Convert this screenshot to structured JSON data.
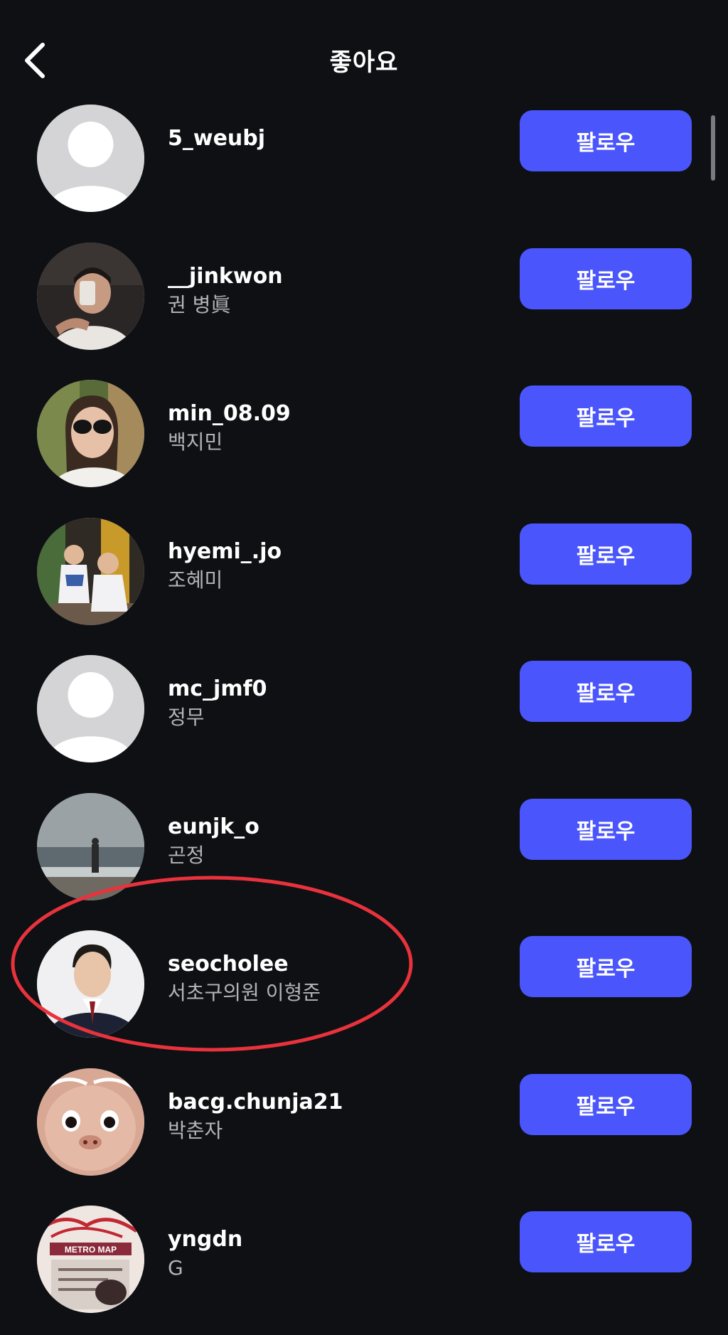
{
  "header": {
    "title": "좋아요",
    "back_icon": "chevron-left-icon"
  },
  "theme": {
    "background": "#0f1014",
    "button_color": "#4a56fb",
    "highlight_color": "#e8323c"
  },
  "users": [
    {
      "username": "5_weubj",
      "full_name": "",
      "button_label": "팔로우",
      "avatar": "default-avatar"
    },
    {
      "username": "__jinkwon",
      "full_name": "권 병眞",
      "button_label": "팔로우",
      "avatar": "photo"
    },
    {
      "username": "min_08.09",
      "full_name": "백지민",
      "button_label": "팔로우",
      "avatar": "photo"
    },
    {
      "username": "hyemi_.jo",
      "full_name": "조혜미",
      "button_label": "팔로우",
      "avatar": "photo"
    },
    {
      "username": "mc_jmf0",
      "full_name": "정무",
      "button_label": "팔로우",
      "avatar": "default-avatar"
    },
    {
      "username": "eunjk_o",
      "full_name": "곤정",
      "button_label": "팔로우",
      "avatar": "photo"
    },
    {
      "username": "seocholee",
      "full_name": "서초구의원 이형준",
      "button_label": "팔로우",
      "avatar": "photo",
      "highlighted": true
    },
    {
      "username": "bacg.chunja21",
      "full_name": "박춘자",
      "button_label": "팔로우",
      "avatar": "photo"
    },
    {
      "username": "yngdn",
      "full_name": "G",
      "button_label": "팔로우",
      "avatar": "photo",
      "avatar_text": "METRO MAP"
    }
  ]
}
